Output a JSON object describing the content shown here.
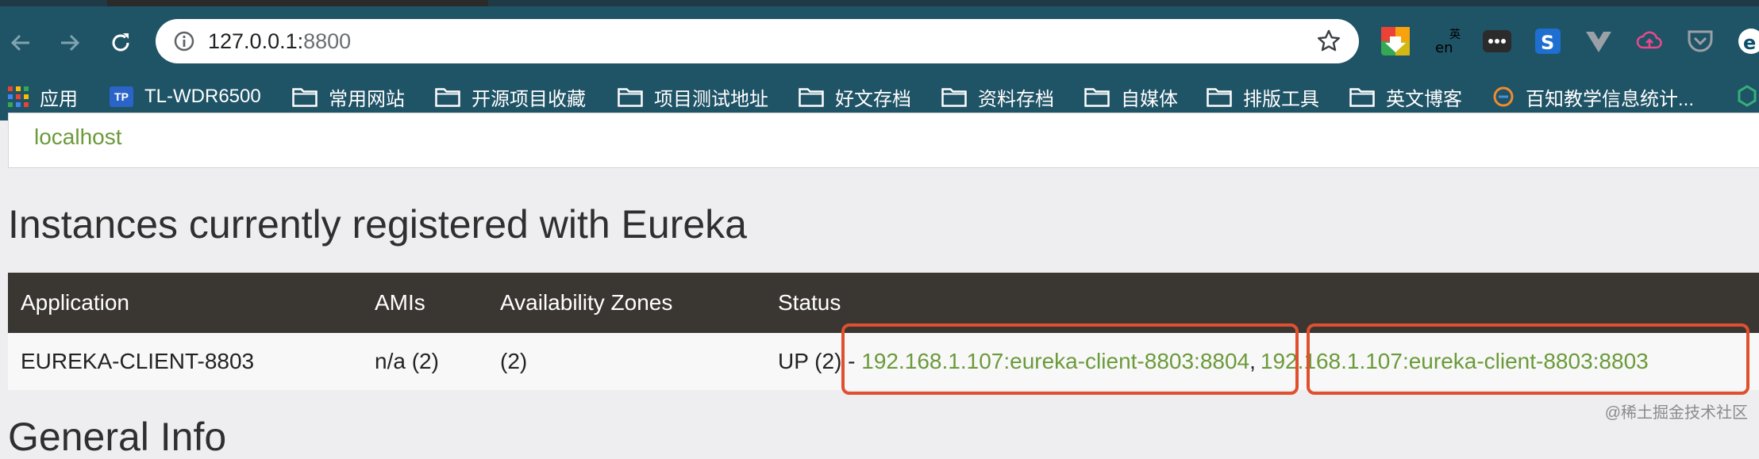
{
  "browser": {
    "url_host": "127.0.0.1:",
    "url_port": "8800"
  },
  "bookmarks": [
    {
      "label": "应用",
      "icon": "apps-grid-icon"
    },
    {
      "label": "TL-WDR6500",
      "icon": "tp-link-icon",
      "badge": "TP"
    },
    {
      "label": "常用网站",
      "icon": "folder-icon"
    },
    {
      "label": "开源项目收藏",
      "icon": "folder-icon"
    },
    {
      "label": "项目测试地址",
      "icon": "folder-icon"
    },
    {
      "label": "好文存档",
      "icon": "folder-icon"
    },
    {
      "label": "资料存档",
      "icon": "folder-icon"
    },
    {
      "label": "自媒体",
      "icon": "folder-icon"
    },
    {
      "label": "排版工具",
      "icon": "folder-icon"
    },
    {
      "label": "英文博客",
      "icon": "folder-icon"
    },
    {
      "label": "百知教学信息统计...",
      "icon": "bookmark-site-icon"
    }
  ],
  "host": "localhost",
  "heading": "Instances currently registered with Eureka",
  "table": {
    "headers": [
      "Application",
      "AMIs",
      "Availability Zones",
      "Status"
    ],
    "rows": [
      {
        "application": "EUREKA-CLIENT-8803",
        "amis": "n/a (2)",
        "zones": "(2)",
        "status_prefix": "UP (2) - ",
        "instance1": "192.168.1.107:eureka-client-8803:8804",
        "separator": ",",
        "instance2": "192.168.1.107:eureka-client-8803:8803"
      }
    ]
  },
  "next_heading_partial": "General Info",
  "watermark": "@稀土掘金技术社区",
  "colors": {
    "toolbar": "#1f5366",
    "link": "#6b9a3a",
    "table_header": "#3a3632",
    "highlight": "#e0502e"
  }
}
